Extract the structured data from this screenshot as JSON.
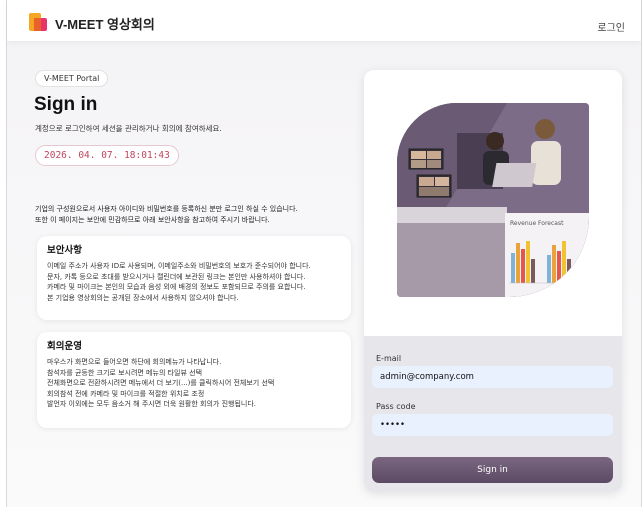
{
  "header": {
    "brand": "V-MEET 영상회의",
    "login_link": "로그인"
  },
  "intro": {
    "pill": "V-MEET Portal",
    "title": "Sign in",
    "subtitle": "계정으로 로그인하여 세션을 관리하거나 회의에 참여하세요.",
    "datetime": "2026. 04. 07. 18:01:43",
    "notice_lines": [
      "기업의 구성원으로서 사용자 아이디와 비밀번호를 등록하신 분만 로그인 하실 수 있습니다.",
      "또한 이 페이지는 보안에 민감하므로 아래 보안사항을 참고하여 주시기 바랍니다."
    ]
  },
  "security": {
    "title": "보안사항",
    "lines": [
      "이메일 주소가 사용자 ID로 사용되며, 이메일주소와 비밀번호의 보호가 준수되어야 합니다.",
      "문자, 카톡 등으로 초대를 받으시거나 캘린더에 보관된 링크는 본인만 사용하셔야 합니다.",
      "카메라 및 마이크는 본인의 모습과 음성 외에 배경의 정보도 포함되므로 주의를 요합니다.",
      "본 기업용 영상회의는 공개된 장소에서 사용하지 않으셔야 합니다."
    ]
  },
  "meeting": {
    "title": "회의운영",
    "lines": [
      "마우스가 화면으로 들어오면 하단에 회의메뉴가 나타납니다.",
      "참석자를 균등한 크기로 보시려면 메뉴의 타일뷰 선택",
      "전체화면으로 전환하시려면 메뉴에서 더 보기(...)를 클릭하시어 전체보기 선택",
      "회의참석 전에 카메라 및 마이크를 적절한 위치로 조정",
      "발언자 이외에는 모두 음소거 해 주시면 더욱 원활한 회의가 진행됩니다."
    ]
  },
  "hero_chart_title": "Revenue Forecast",
  "form": {
    "email_label": "E-mail",
    "email_value": "admin@company.com",
    "pass_label": "Pass code",
    "pass_value": "•••••",
    "signin_label": "Sign in"
  },
  "colors": {
    "accent": "#5c4a64",
    "datetime": "#c0465e",
    "input_bg": "#e9f0fe"
  }
}
